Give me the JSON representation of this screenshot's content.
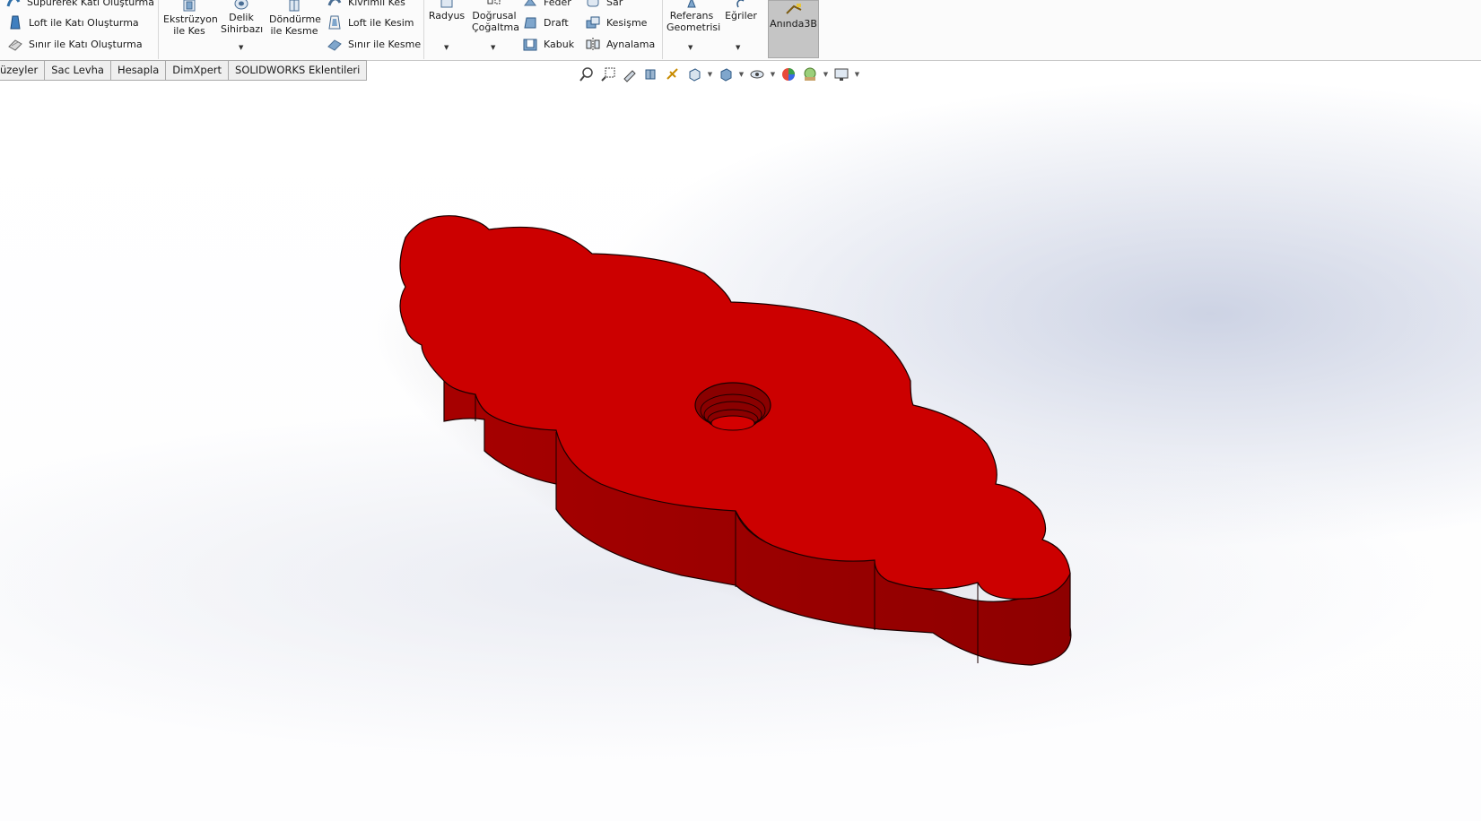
{
  "ribbon": {
    "group1": {
      "swept": "Süpürerek Katı Oluşturma",
      "loft": "Loft ile Katı Oluşturma",
      "boundary": "Sınır ile Katı Oluşturma"
    },
    "group2": {
      "extrude_cut": "Ekstrüzyon ile Kes",
      "hole_wizard": "Delik Sihirbazı",
      "revolve_cut": "Döndürme ile Kesme",
      "swept_cut": "Kıvrımlı Kes",
      "lofted_cut": "Loft ile Kesim",
      "boundary_cut": "Sınır ile Kesme"
    },
    "group3": {
      "fillet": "Radyus",
      "linear_pattern": "Doğrusal Çoğaltma",
      "rib": "Feder",
      "wrap": "Sar",
      "draft": "Draft",
      "intersect": "Kesişme",
      "shell": "Kabuk",
      "mirror": "Aynalama"
    },
    "group4": {
      "ref_geometry": "Referans Geometrisi",
      "curves": "Eğriler",
      "instant3d": "Anında3B"
    }
  },
  "tabs": [
    {
      "label": "üzeyler"
    },
    {
      "label": "Sac Levha"
    },
    {
      "label": "Hesapla"
    },
    {
      "label": "DimXpert"
    },
    {
      "label": "SOLIDWORKS Eklentileri"
    }
  ],
  "heads_up_toolbar": [
    "zoom-to-fit-icon",
    "zoom-to-area-icon",
    "previous-view-icon",
    "section-view-icon",
    "dynamic-annotation-icon",
    "view-orientation-icon",
    "display-style-icon",
    "hide-show-items-icon",
    "edit-appearance-icon",
    "apply-scene-icon",
    "view-settings-icon"
  ],
  "model": {
    "part": "threaded-knob-plate",
    "colors": {
      "top": "#cc0000",
      "side": "#a80000",
      "side_dark": "#7a0000",
      "edge": "#1a0000"
    }
  }
}
